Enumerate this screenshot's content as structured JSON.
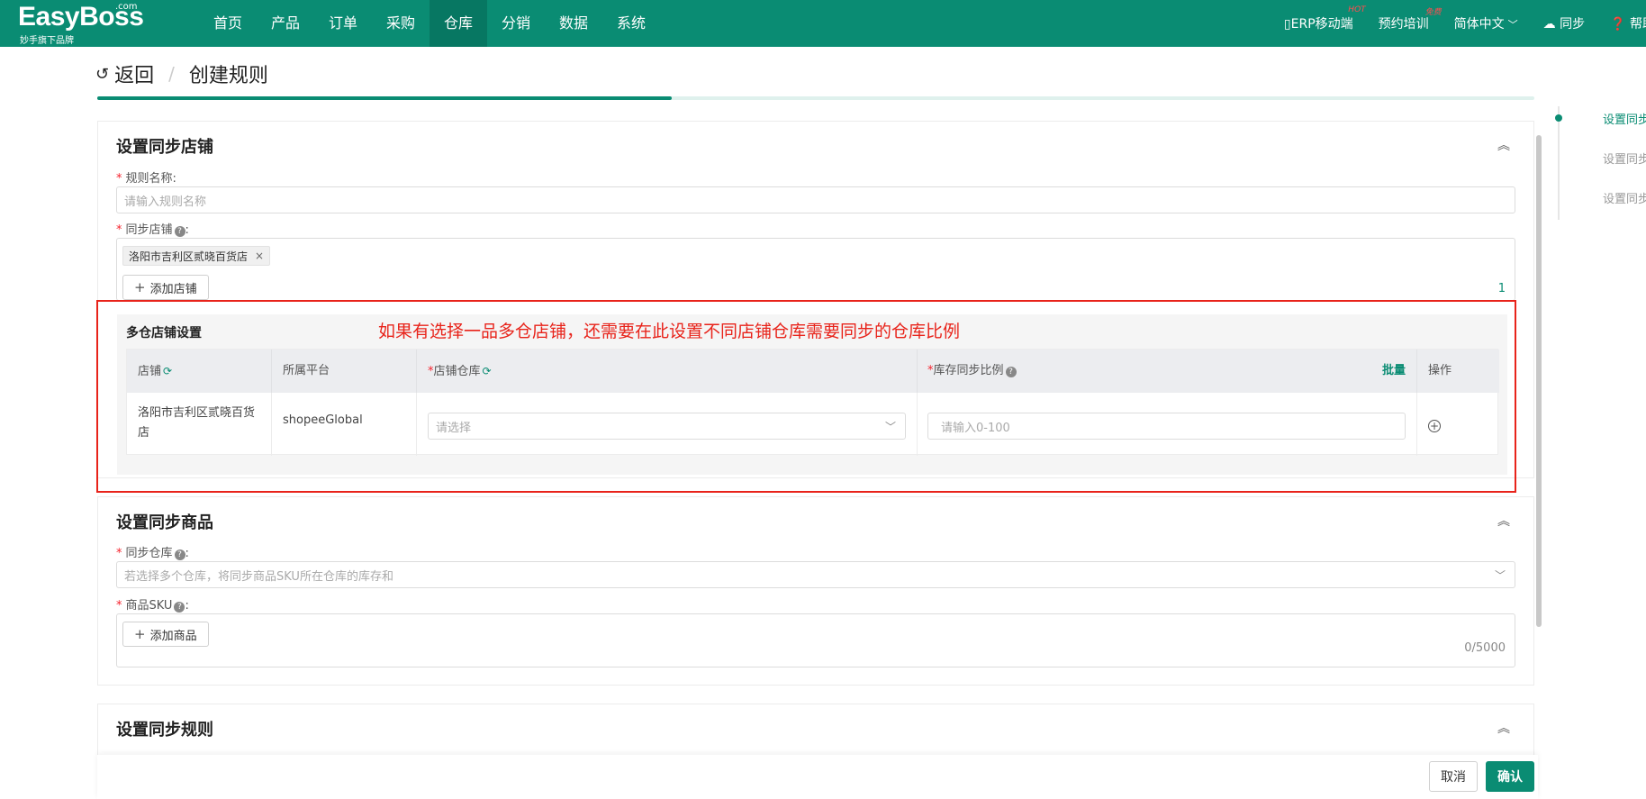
{
  "brand": {
    "name": "EasyBoss",
    "domain_suffix": ".com",
    "tagline": "妙手旗下品牌"
  },
  "nav": {
    "items": [
      "首页",
      "产品",
      "订单",
      "采购",
      "仓库",
      "分销",
      "数据",
      "系统"
    ],
    "active": "仓库"
  },
  "tools": {
    "mobile": "ERP移动端",
    "mobile_badge": "HOT",
    "training": "预约培训",
    "training_badge": "免费",
    "language": "简体中文",
    "sync": "同步",
    "help": "帮助"
  },
  "header": {
    "back": "返回",
    "title": "创建规则"
  },
  "progress": {
    "percent": 0.4
  },
  "anchors": [
    "设置同步店铺",
    "设置同步商品",
    "设置同步规则"
  ],
  "section_store": {
    "title": "设置同步店铺",
    "rule_name_label": "规则名称:",
    "rule_name_placeholder": "请输入规则名称",
    "store_label": "同步店铺",
    "store_tag": "洛阳市吉利区贰晓百货店",
    "add_store": "添加店铺",
    "store_count": "1"
  },
  "multi_warehouse": {
    "title": "多仓店铺设置",
    "headers": {
      "store": "店铺",
      "platform": "所属平台",
      "warehouse": "店铺仓库",
      "ratio": "库存同步比例",
      "batch": "批量",
      "action": "操作"
    },
    "row": {
      "store": "洛阳市吉利区贰晓百货店",
      "platform": "shopeeGlobal",
      "warehouse_placeholder": "请选择",
      "ratio_placeholder": "请输入0-100"
    }
  },
  "annotation": "如果有选择一品多仓店铺，还需要在此设置不同店铺仓库需要同步的仓库比例",
  "section_goods": {
    "title": "设置同步商品",
    "warehouse_label": "同步仓库",
    "warehouse_placeholder": "若选择多个仓库，将同步商品SKU所在仓库的库存和",
    "sku_label": "商品SKU",
    "add_goods": "添加商品",
    "sku_count": "0/5000"
  },
  "section_rule": {
    "title": "设置同步规则"
  },
  "footer": {
    "cancel": "取消",
    "confirm": "确认"
  },
  "colors": {
    "primary": "#0a8c73",
    "annotation": "#e8231a",
    "required": "#f5222d"
  }
}
